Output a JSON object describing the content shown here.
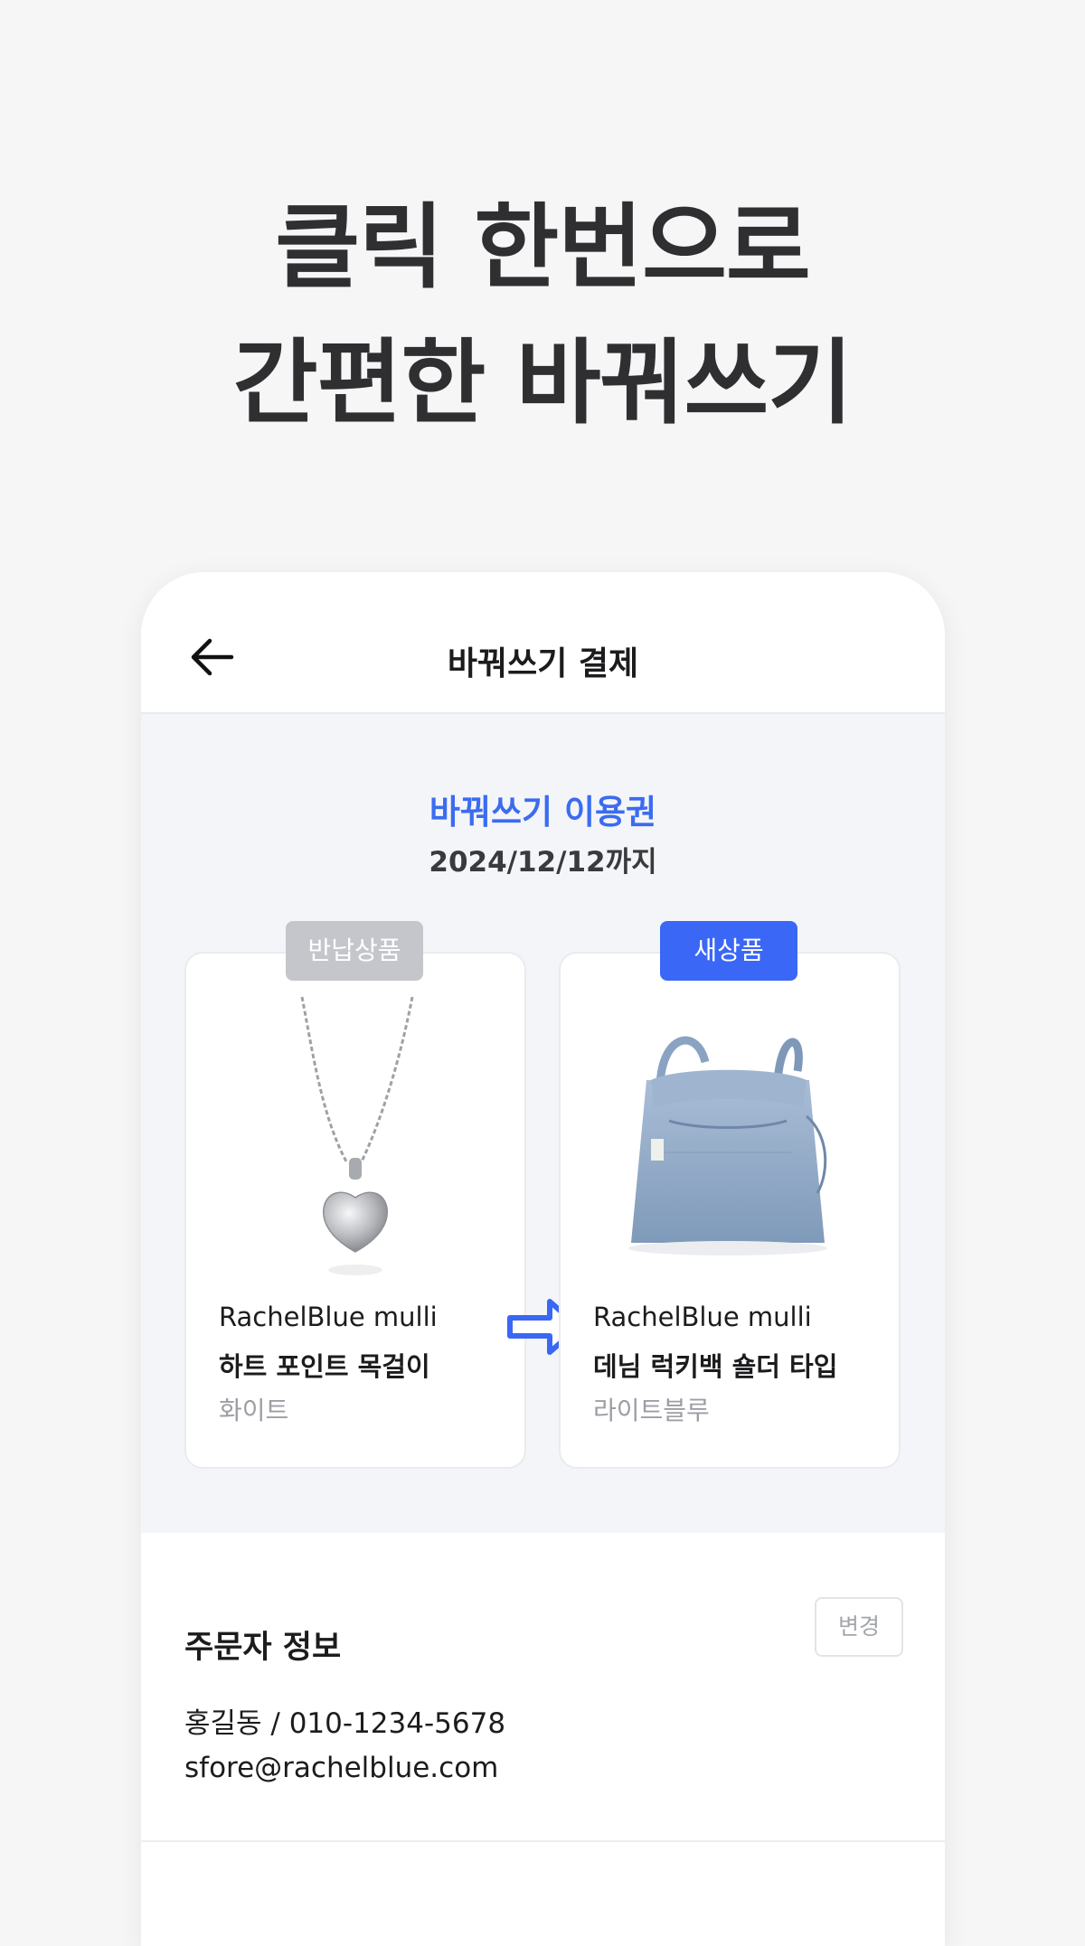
{
  "hero": {
    "line1": "클릭 한번으로",
    "line2": "간편한 바꿔쓰기"
  },
  "appbar": {
    "back_icon": "arrow-left-icon",
    "title": "바꿔쓰기 결제"
  },
  "voucher": {
    "title": "바꿔쓰기 이용권",
    "date": "2024/12/12까지",
    "accent_color": "#3b6cf0"
  },
  "return_product": {
    "tag": "반납상품",
    "brand": "RachelBlue mulli",
    "name": "하트 포인트 목걸이",
    "option": "화이트",
    "image": "heart-necklace-image"
  },
  "arrow_icon": "arrow-right-icon",
  "new_product": {
    "tag": "새상품",
    "brand": "RachelBlue mulli",
    "name": "데님 럭키백 숄더 타입",
    "option": "라이트블루",
    "image": "denim-bag-image"
  },
  "order_info": {
    "title": "주문자 정보",
    "change_label": "변경",
    "name_phone": "홍길동 / 010-1234-5678",
    "email": "sfore@rachelblue.com"
  }
}
